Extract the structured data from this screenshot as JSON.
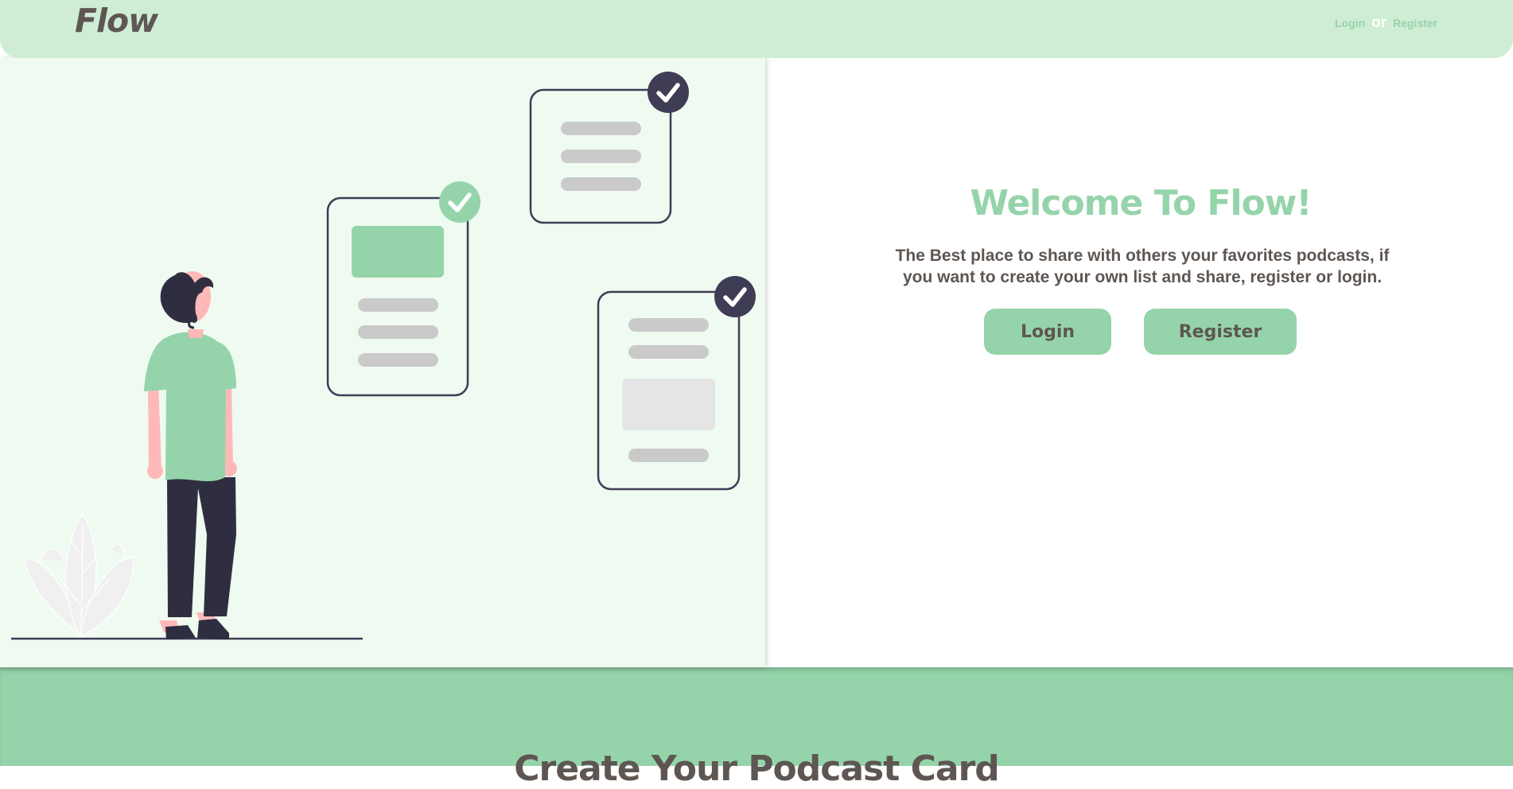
{
  "header": {
    "logo": "Flow",
    "nav": {
      "login": "Login",
      "separator": "or",
      "register": "Register"
    }
  },
  "hero": {
    "title": "Welcome To Flow!",
    "description": "The Best place to share with others your favorites podcasts, if you want to create your own list and share, register or login.",
    "login_button": "Login",
    "register_button": "Register"
  },
  "section": {
    "title": "Create Your Podcast Card"
  },
  "colors": {
    "header_bg": "#cfedd4",
    "accent": "#95d4aa",
    "text": "#5e5652",
    "hero_left_bg": "#effbf0",
    "dark_navy": "#3f3d56"
  },
  "illustration": {
    "name": "person-with-checklist-cards",
    "checked_cards": 3
  }
}
